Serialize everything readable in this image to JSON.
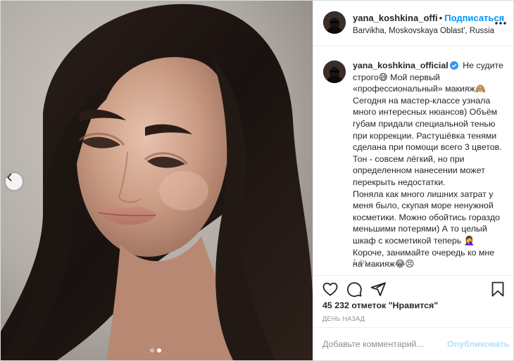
{
  "header": {
    "username": "yana_koshkina_offi",
    "separator": "•",
    "follow_label": "Подписаться",
    "location": "Barvikha, Moskovskaya Oblast', Russia",
    "more_icon": "more-horizontal-icon"
  },
  "caption": {
    "username": "yana_koshkina_official",
    "text": " Не судите строго😅 Мой первый «профессиональный» макияж🙈\nСегодня на мастер-классе узнала много интересных нюансов) Объём губам придали специальной тенью при коррекции. Растушёвка тенями сделана при помощи всего 3 цветов. Тон - совсем лёгкий, но при определенном нанесении может перекрыть недостатки.\nПоняла как много лишних затрат у меня было, скупая море ненужной косметики. Можно обойтись гораздо меньшими потерями) А то целый шкаф с косметикой теперь 🤦‍♀️ Короче, занимайте очередь ко мне на макияж😂😣",
    "time": "1 дн."
  },
  "actions": {
    "icons": [
      "heart-icon",
      "comment-icon",
      "share-icon",
      "bookmark-icon"
    ],
    "likes": "45 232 отметок \"Нравится\"",
    "date": "ДЕНЬ НАЗАД"
  },
  "comment": {
    "placeholder": "Добавьте комментарий...",
    "publish_label": "Опубликовать"
  },
  "carousel": {
    "slide_count": 2,
    "active_slide": 2
  },
  "colors": {
    "accent": "#0095f6",
    "publish_disabled": "#b2dffc",
    "muted": "#8e8e8e",
    "verified": "#3897f0"
  }
}
